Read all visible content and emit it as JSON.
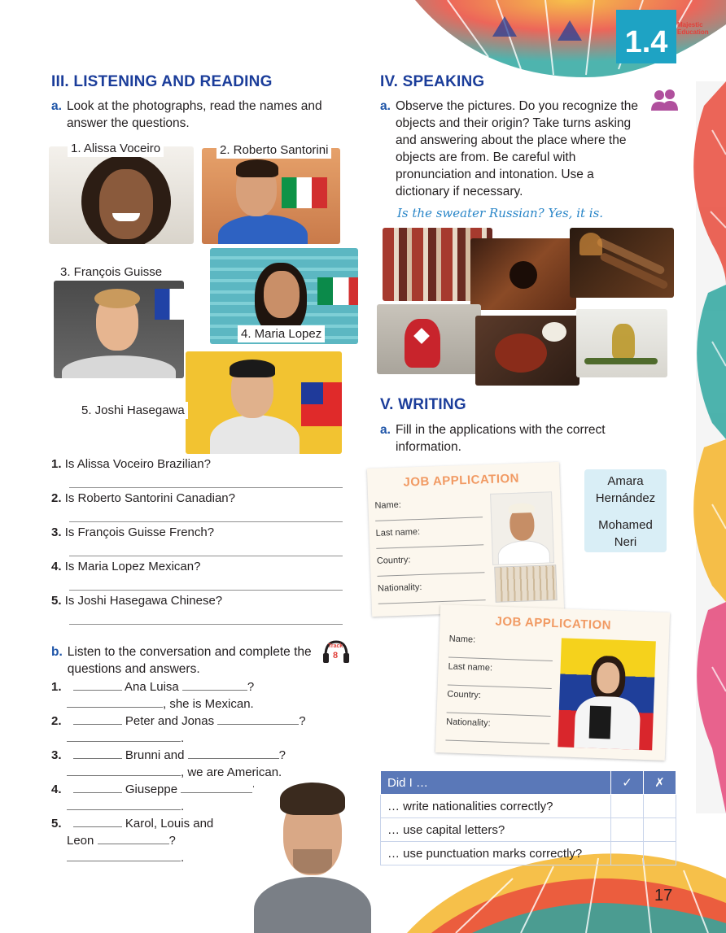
{
  "header": {
    "unit_badge": "1.4",
    "brand_line1": "Majestic",
    "brand_line2": "Education"
  },
  "page_number": "17",
  "listening": {
    "title": "III. LISTENING AND READING",
    "a_letter": "a.",
    "a_text": "Look at the photographs, read the names and answer the questions.",
    "names": [
      "1. Alissa Voceiro",
      "2. Roberto Santorini",
      "3. François Guisse",
      "4. Maria Lopez",
      "5. Joshi Hasegawa"
    ],
    "questions": [
      {
        "num": "1.",
        "text": "Is Alissa Voceiro Brazilian?"
      },
      {
        "num": "2.",
        "text": "Is Roberto Santorini Canadian?"
      },
      {
        "num": "3.",
        "text": "Is François Guisse French?"
      },
      {
        "num": "4.",
        "text": "Is Maria Lopez Mexican?"
      },
      {
        "num": "5.",
        "text": "Is Joshi Hasegawa Chinese?"
      }
    ],
    "b_letter": "b.",
    "b_text": "Listen to the conversation and complete the questions and answers.",
    "track_label": "Track",
    "track_number": "8",
    "b_items": {
      "n1": "1.",
      "t1a": "Ana Luisa",
      "t1b": "?",
      "t1c": ", she is Mexican.",
      "n2": "2.",
      "t2a": "Peter and Jonas",
      "t2b": "?",
      "t2c": ".",
      "n3": "3.",
      "t3a": "Brunni and",
      "t3b": "?",
      "t3c": ", we are American.",
      "n4": "4.",
      "t4a": "Giuseppe",
      "t4b": "?",
      "t4c": ".",
      "n5": "5.",
      "t5a": "Karol, Louis and",
      "t5b": "Leon",
      "t5c": "?",
      "t5d": "."
    }
  },
  "speaking": {
    "title": "IV. SPEAKING",
    "a_letter": "a.",
    "a_text": "Observe the pictures. Do you recognize the objects and their origin? Take turns asking and answering about the place where the objects are from. Be careful with pronunciation and intonation. Use a dictionary if necessary.",
    "example": "Is the sweater Russian? Yes, it is."
  },
  "writing": {
    "title": "V. WRITING",
    "a_letter": "a.",
    "a_text": "Fill in the applications with the correct information.",
    "app_title": "JOB APPLICATION",
    "fields": [
      "Name:",
      "Last name:",
      "Country:",
      "Nationality:"
    ],
    "names_box": [
      "Amara",
      "Hernández",
      "Mohamed",
      "Neri"
    ]
  },
  "checklist": {
    "header": "Did I …",
    "check_symbol": "✓",
    "cross_symbol": "✗",
    "rows": [
      "… write nationalities correctly?",
      "… use capital letters?",
      "… use punctuation marks correctly?"
    ]
  },
  "colors": {
    "heading_blue": "#1b3d9a",
    "badge_teal": "#1ea3c4",
    "app_orange": "#f19a63",
    "table_header": "#5a78b8",
    "names_box_bg": "#d9eef6"
  }
}
